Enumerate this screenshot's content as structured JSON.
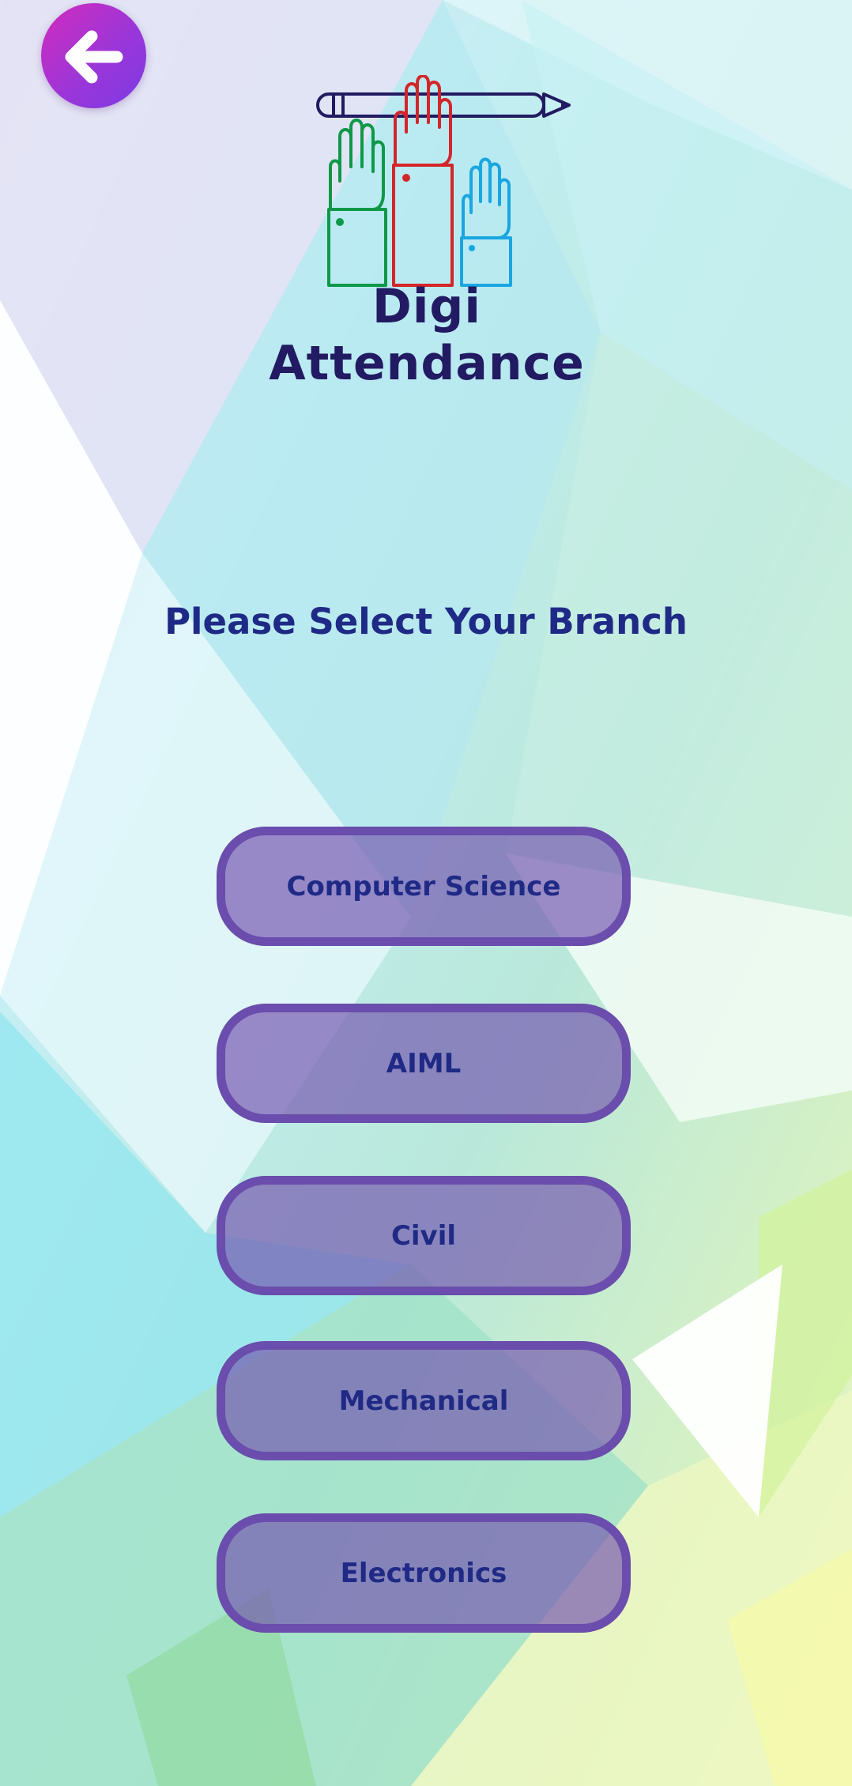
{
  "app": {
    "title": "Digi Attendance"
  },
  "header": {
    "back_icon": "arrow-left-icon"
  },
  "main": {
    "heading": "Please Select Your Branch",
    "branches": [
      {
        "label": "Computer Science"
      },
      {
        "label": "AIML"
      },
      {
        "label": "Civil"
      },
      {
        "label": "Mechanical"
      },
      {
        "label": "Electronics"
      }
    ]
  },
  "colors": {
    "heading_text": "#1f2a86",
    "button_border": "#6a4dac",
    "button_fill": "#7556b0",
    "back_button_start": "#d22bbd",
    "back_button_end": "#7b3ae6",
    "logo_green": "#0f9848",
    "logo_red": "#d3262a",
    "logo_blue": "#1aa6e0",
    "logo_navy": "#221a62"
  }
}
